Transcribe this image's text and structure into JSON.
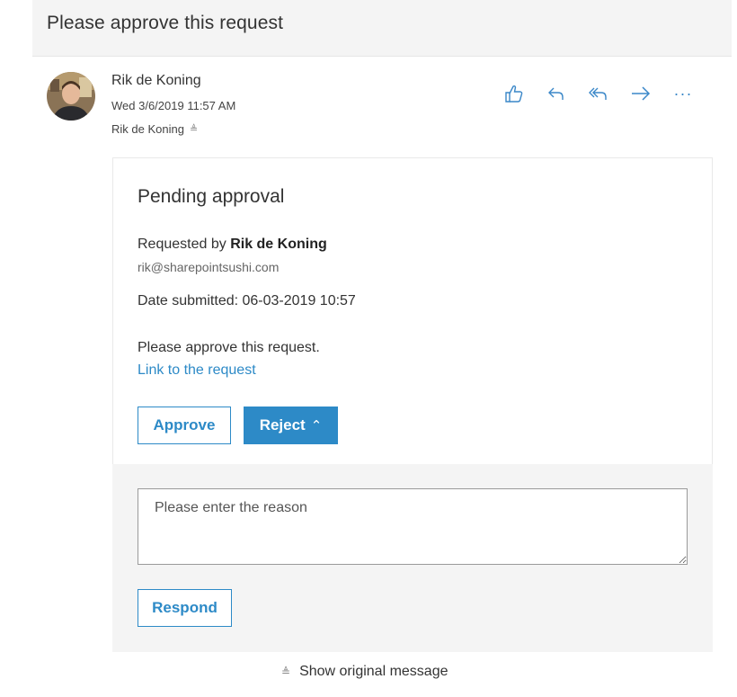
{
  "message": {
    "subject": "Please approve this request",
    "sender_name": "Rik de Koning",
    "date": "Wed 3/6/2019 11:57 AM",
    "to": "Rik de Koning"
  },
  "actions": {
    "icons": [
      "thumbs-up-icon",
      "reply-icon",
      "reply-all-icon",
      "forward-icon",
      "more-icon"
    ],
    "more_label": "···"
  },
  "card": {
    "title": "Pending approval",
    "requested_by_prefix": "Requested by ",
    "requester": "Rik de Koning",
    "requester_email": "rik@sharepointsushi.com",
    "date_submitted": "Date submitted: 06-03-2019 10:57",
    "body": "Please approve this request.",
    "link_text": "Link to the request",
    "approve_label": "Approve",
    "reject_label": "Reject",
    "reason_placeholder": "Please enter the reason",
    "respond_label": "Respond"
  },
  "footer": {
    "show_original": "Show original message"
  },
  "colors": {
    "accent": "#2d8ac7",
    "background": "#f4f4f4"
  }
}
